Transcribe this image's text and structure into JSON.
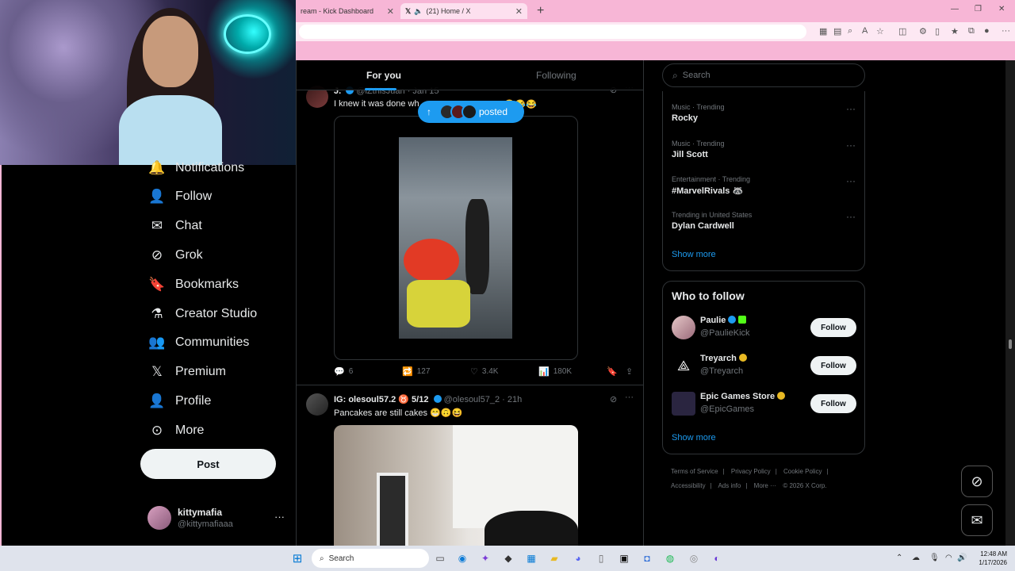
{
  "browser": {
    "tabs": [
      {
        "label": "ream - Kick Dashboard"
      },
      {
        "label": "(21) Home / X"
      }
    ],
    "new_tab": "+",
    "chat_label": "Chat"
  },
  "nav": {
    "items": [
      {
        "label": "Notifications",
        "icon": "bell-icon",
        "glyph": "🔔"
      },
      {
        "label": "Follow",
        "icon": "person-add-icon",
        "glyph": "👤"
      },
      {
        "label": "Chat",
        "icon": "envelope-icon",
        "glyph": "✉"
      },
      {
        "label": "Grok",
        "icon": "grok-icon",
        "glyph": "⊘"
      },
      {
        "label": "Bookmarks",
        "icon": "bookmark-icon",
        "glyph": "🔖"
      },
      {
        "label": "Creator Studio",
        "icon": "flask-icon",
        "glyph": "⚗"
      },
      {
        "label": "Communities",
        "icon": "people-icon",
        "glyph": "👥"
      },
      {
        "label": "Premium",
        "icon": "x-logo-icon",
        "glyph": "𝕏"
      },
      {
        "label": "Profile",
        "icon": "person-icon",
        "glyph": "👤"
      },
      {
        "label": "More",
        "icon": "more-circle-icon",
        "glyph": "⊙"
      }
    ],
    "post_label": "Post",
    "account": {
      "name": "kittymafia",
      "handle": "@kittymafiaaa",
      "more": "···"
    }
  },
  "feed": {
    "tabs": [
      {
        "label": "For you"
      },
      {
        "label": "Following"
      }
    ],
    "posted_pill": {
      "arrow": "↑",
      "label": "posted"
    },
    "tweets": [
      {
        "name": "J.",
        "handle": "@iZthisJuan",
        "time": "Jan 15",
        "text": "I knew it was done wh",
        "text_tail": "bit😂😂😂",
        "stats": {
          "replies": "6",
          "reposts": "127",
          "likes": "3.4K",
          "views": "180K"
        }
      },
      {
        "name": "IG: olesoul57.2 ♉ 5/12",
        "handle": "@olesoul57_2",
        "time": "21h",
        "text": "Pancakes are still cakes 😁🙃😆"
      }
    ]
  },
  "search": {
    "placeholder": "Search"
  },
  "trends": {
    "items": [
      {
        "category": "Music · Trending",
        "name": "Rocky"
      },
      {
        "category": "Music · Trending",
        "name": "Jill Scott"
      },
      {
        "category": "Entertainment · Trending",
        "name": "#MarvelRivals"
      },
      {
        "category": "Trending in United States",
        "name": "Dylan Cardwell"
      }
    ],
    "show_more": "Show more"
  },
  "who_to_follow": {
    "title": "Who to follow",
    "accounts": [
      {
        "name": "Paulie",
        "handle": "@PaulieKick",
        "button": "Follow"
      },
      {
        "name": "Treyarch",
        "handle": "@Treyarch",
        "button": "Follow"
      },
      {
        "name": "Epic Games Store",
        "handle": "@EpicGames",
        "button": "Follow"
      }
    ],
    "show_more": "Show more"
  },
  "footer": {
    "links": [
      "Terms of Service",
      "|",
      "Privacy Policy",
      "|",
      "Cookie Policy",
      "|",
      "Accessibility",
      "|",
      "Ads info",
      "|",
      "More ···",
      "© 2026 X Corp."
    ]
  },
  "taskbar": {
    "search": "Search",
    "time": "12:48 AM",
    "date": "1/17/2026"
  },
  "colors": {
    "accent": "#1d9bf0",
    "browser_pink": "#f7b6d6",
    "background": "#000000"
  }
}
